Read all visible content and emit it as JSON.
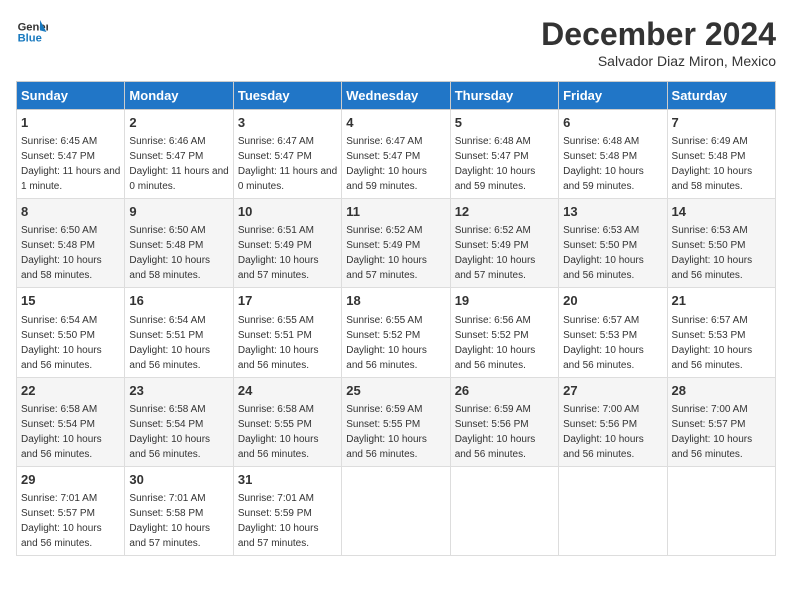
{
  "logo": {
    "line1": "General",
    "line2": "Blue"
  },
  "title": "December 2024",
  "location": "Salvador Diaz Miron, Mexico",
  "days_header": [
    "Sunday",
    "Monday",
    "Tuesday",
    "Wednesday",
    "Thursday",
    "Friday",
    "Saturday"
  ],
  "weeks": [
    [
      {
        "day": "1",
        "sunrise": "6:45 AM",
        "sunset": "5:47 PM",
        "daylight": "11 hours and 1 minute."
      },
      {
        "day": "2",
        "sunrise": "6:46 AM",
        "sunset": "5:47 PM",
        "daylight": "11 hours and 0 minutes."
      },
      {
        "day": "3",
        "sunrise": "6:47 AM",
        "sunset": "5:47 PM",
        "daylight": "11 hours and 0 minutes."
      },
      {
        "day": "4",
        "sunrise": "6:47 AM",
        "sunset": "5:47 PM",
        "daylight": "10 hours and 59 minutes."
      },
      {
        "day": "5",
        "sunrise": "6:48 AM",
        "sunset": "5:47 PM",
        "daylight": "10 hours and 59 minutes."
      },
      {
        "day": "6",
        "sunrise": "6:48 AM",
        "sunset": "5:48 PM",
        "daylight": "10 hours and 59 minutes."
      },
      {
        "day": "7",
        "sunrise": "6:49 AM",
        "sunset": "5:48 PM",
        "daylight": "10 hours and 58 minutes."
      }
    ],
    [
      {
        "day": "8",
        "sunrise": "6:50 AM",
        "sunset": "5:48 PM",
        "daylight": "10 hours and 58 minutes."
      },
      {
        "day": "9",
        "sunrise": "6:50 AM",
        "sunset": "5:48 PM",
        "daylight": "10 hours and 58 minutes."
      },
      {
        "day": "10",
        "sunrise": "6:51 AM",
        "sunset": "5:49 PM",
        "daylight": "10 hours and 57 minutes."
      },
      {
        "day": "11",
        "sunrise": "6:52 AM",
        "sunset": "5:49 PM",
        "daylight": "10 hours and 57 minutes."
      },
      {
        "day": "12",
        "sunrise": "6:52 AM",
        "sunset": "5:49 PM",
        "daylight": "10 hours and 57 minutes."
      },
      {
        "day": "13",
        "sunrise": "6:53 AM",
        "sunset": "5:50 PM",
        "daylight": "10 hours and 56 minutes."
      },
      {
        "day": "14",
        "sunrise": "6:53 AM",
        "sunset": "5:50 PM",
        "daylight": "10 hours and 56 minutes."
      }
    ],
    [
      {
        "day": "15",
        "sunrise": "6:54 AM",
        "sunset": "5:50 PM",
        "daylight": "10 hours and 56 minutes."
      },
      {
        "day": "16",
        "sunrise": "6:54 AM",
        "sunset": "5:51 PM",
        "daylight": "10 hours and 56 minutes."
      },
      {
        "day": "17",
        "sunrise": "6:55 AM",
        "sunset": "5:51 PM",
        "daylight": "10 hours and 56 minutes."
      },
      {
        "day": "18",
        "sunrise": "6:55 AM",
        "sunset": "5:52 PM",
        "daylight": "10 hours and 56 minutes."
      },
      {
        "day": "19",
        "sunrise": "6:56 AM",
        "sunset": "5:52 PM",
        "daylight": "10 hours and 56 minutes."
      },
      {
        "day": "20",
        "sunrise": "6:57 AM",
        "sunset": "5:53 PM",
        "daylight": "10 hours and 56 minutes."
      },
      {
        "day": "21",
        "sunrise": "6:57 AM",
        "sunset": "5:53 PM",
        "daylight": "10 hours and 56 minutes."
      }
    ],
    [
      {
        "day": "22",
        "sunrise": "6:58 AM",
        "sunset": "5:54 PM",
        "daylight": "10 hours and 56 minutes."
      },
      {
        "day": "23",
        "sunrise": "6:58 AM",
        "sunset": "5:54 PM",
        "daylight": "10 hours and 56 minutes."
      },
      {
        "day": "24",
        "sunrise": "6:58 AM",
        "sunset": "5:55 PM",
        "daylight": "10 hours and 56 minutes."
      },
      {
        "day": "25",
        "sunrise": "6:59 AM",
        "sunset": "5:55 PM",
        "daylight": "10 hours and 56 minutes."
      },
      {
        "day": "26",
        "sunrise": "6:59 AM",
        "sunset": "5:56 PM",
        "daylight": "10 hours and 56 minutes."
      },
      {
        "day": "27",
        "sunrise": "7:00 AM",
        "sunset": "5:56 PM",
        "daylight": "10 hours and 56 minutes."
      },
      {
        "day": "28",
        "sunrise": "7:00 AM",
        "sunset": "5:57 PM",
        "daylight": "10 hours and 56 minutes."
      }
    ],
    [
      {
        "day": "29",
        "sunrise": "7:01 AM",
        "sunset": "5:57 PM",
        "daylight": "10 hours and 56 minutes."
      },
      {
        "day": "30",
        "sunrise": "7:01 AM",
        "sunset": "5:58 PM",
        "daylight": "10 hours and 57 minutes."
      },
      {
        "day": "31",
        "sunrise": "7:01 AM",
        "sunset": "5:59 PM",
        "daylight": "10 hours and 57 minutes."
      },
      null,
      null,
      null,
      null
    ]
  ],
  "labels": {
    "sunrise": "Sunrise:",
    "sunset": "Sunset:",
    "daylight": "Daylight:"
  }
}
